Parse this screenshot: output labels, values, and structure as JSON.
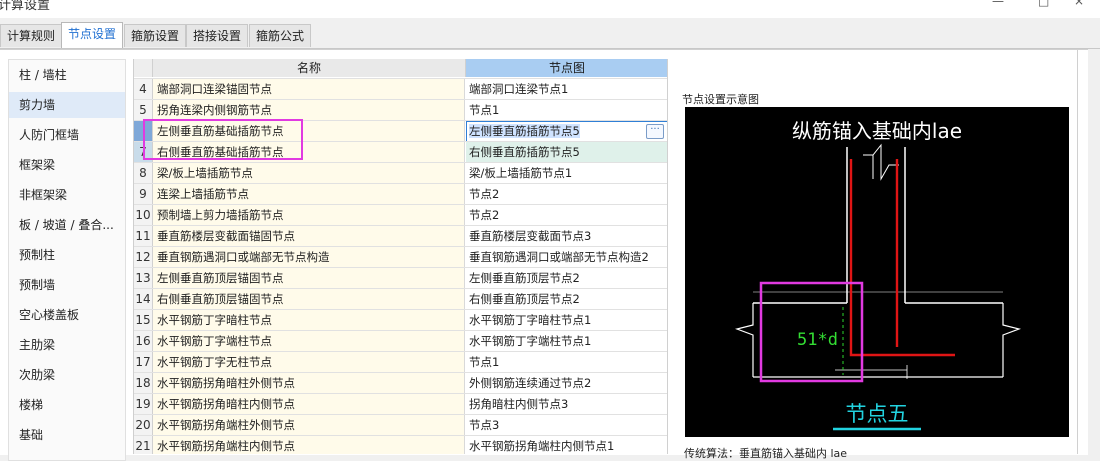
{
  "window": {
    "title": "计算设置",
    "controls": [
      "—",
      "□",
      "×"
    ]
  },
  "tabs": [
    {
      "label": "计算规则",
      "active": false
    },
    {
      "label": "节点设置",
      "active": true
    },
    {
      "label": "箍筋设置",
      "active": false
    },
    {
      "label": "搭接设置",
      "active": false
    },
    {
      "label": "箍筋公式",
      "active": false
    }
  ],
  "sidebar": {
    "items": [
      {
        "label": "柱 / 墙柱"
      },
      {
        "label": "剪力墙"
      },
      {
        "label": "人防门框墙"
      },
      {
        "label": "框架梁"
      },
      {
        "label": "非框架梁"
      },
      {
        "label": "板 / 坡道 / 叠合..."
      },
      {
        "label": "预制柱"
      },
      {
        "label": "预制墙"
      },
      {
        "label": "空心楼盖板"
      },
      {
        "label": "主肋梁"
      },
      {
        "label": "次肋梁"
      },
      {
        "label": "楼梯"
      },
      {
        "label": "基础"
      }
    ],
    "selected": "剪力墙"
  },
  "grid": {
    "headers": {
      "name": "名称",
      "node": "节点图"
    },
    "rows": [
      {
        "num": "4",
        "name": "端部洞口连梁锚固节点",
        "node": "端部洞口连梁节点1"
      },
      {
        "num": "5",
        "name": "拐角连梁内侧钢筋节点",
        "node": "节点1"
      },
      {
        "num": "6",
        "name": "左侧垂直筋基础插筋节点",
        "node": "左侧垂直筋插筋节点5"
      },
      {
        "num": "7",
        "name": "右侧垂直筋基础插筋节点",
        "node": "右侧垂直筋插筋节点5"
      },
      {
        "num": "8",
        "name": "梁/板上墙插筋节点",
        "node": "梁/板上墙插筋节点1"
      },
      {
        "num": "9",
        "name": "连梁上墙插筋节点",
        "node": "节点2"
      },
      {
        "num": "10",
        "name": "预制墙上剪力墙插筋节点",
        "node": "节点2"
      },
      {
        "num": "11",
        "name": "垂直筋楼层变截面锚固节点",
        "node": "垂直筋楼层变截面节点3"
      },
      {
        "num": "12",
        "name": "垂直钢筋遇洞口或端部无节点构造",
        "node": "垂直钢筋遇洞口或端部无节点构造2"
      },
      {
        "num": "13",
        "name": "左侧垂直筋顶层锚固节点",
        "node": "左侧垂直筋顶层节点2"
      },
      {
        "num": "14",
        "name": "右侧垂直筋顶层锚固节点",
        "node": "右侧垂直筋顶层节点2"
      },
      {
        "num": "15",
        "name": "水平钢筋丁字暗柱节点",
        "node": "水平钢筋丁字暗柱节点1"
      },
      {
        "num": "16",
        "name": "水平钢筋丁字端柱节点",
        "node": "水平钢筋丁字端柱节点1"
      },
      {
        "num": "17",
        "name": "水平钢筋丁字无柱节点",
        "node": "节点1"
      },
      {
        "num": "18",
        "name": "水平钢筋拐角暗柱外侧节点",
        "node": "外侧钢筋连续通过节点2"
      },
      {
        "num": "19",
        "name": "水平钢筋拐角暗柱内侧节点",
        "node": "拐角暗柱内侧节点3"
      },
      {
        "num": "20",
        "name": "水平钢筋拐角端柱外侧节点",
        "node": "节点3"
      },
      {
        "num": "21",
        "name": "水平钢筋拐角端柱内侧节点",
        "node": "水平钢筋拐角端柱内侧节点1"
      }
    ],
    "editing_row_index": 2,
    "editor_button": "···"
  },
  "preview": {
    "title": "节点设置示意图",
    "diagram_heading": "纵筋锚入基础内lae",
    "anchor_label": "51*d",
    "node_name": "节点五",
    "caption": "传统算法：垂直筋锚入基础内 lae"
  },
  "colors": {
    "accent": "#1f6fd1",
    "header_selected": "#a9cdf2",
    "name_cell_bg": "#fffbea",
    "highlight_box": "#e13ae1",
    "rebar_red": "#e01515",
    "label_green": "#33dd33",
    "node_cyan": "#22d3e0"
  }
}
